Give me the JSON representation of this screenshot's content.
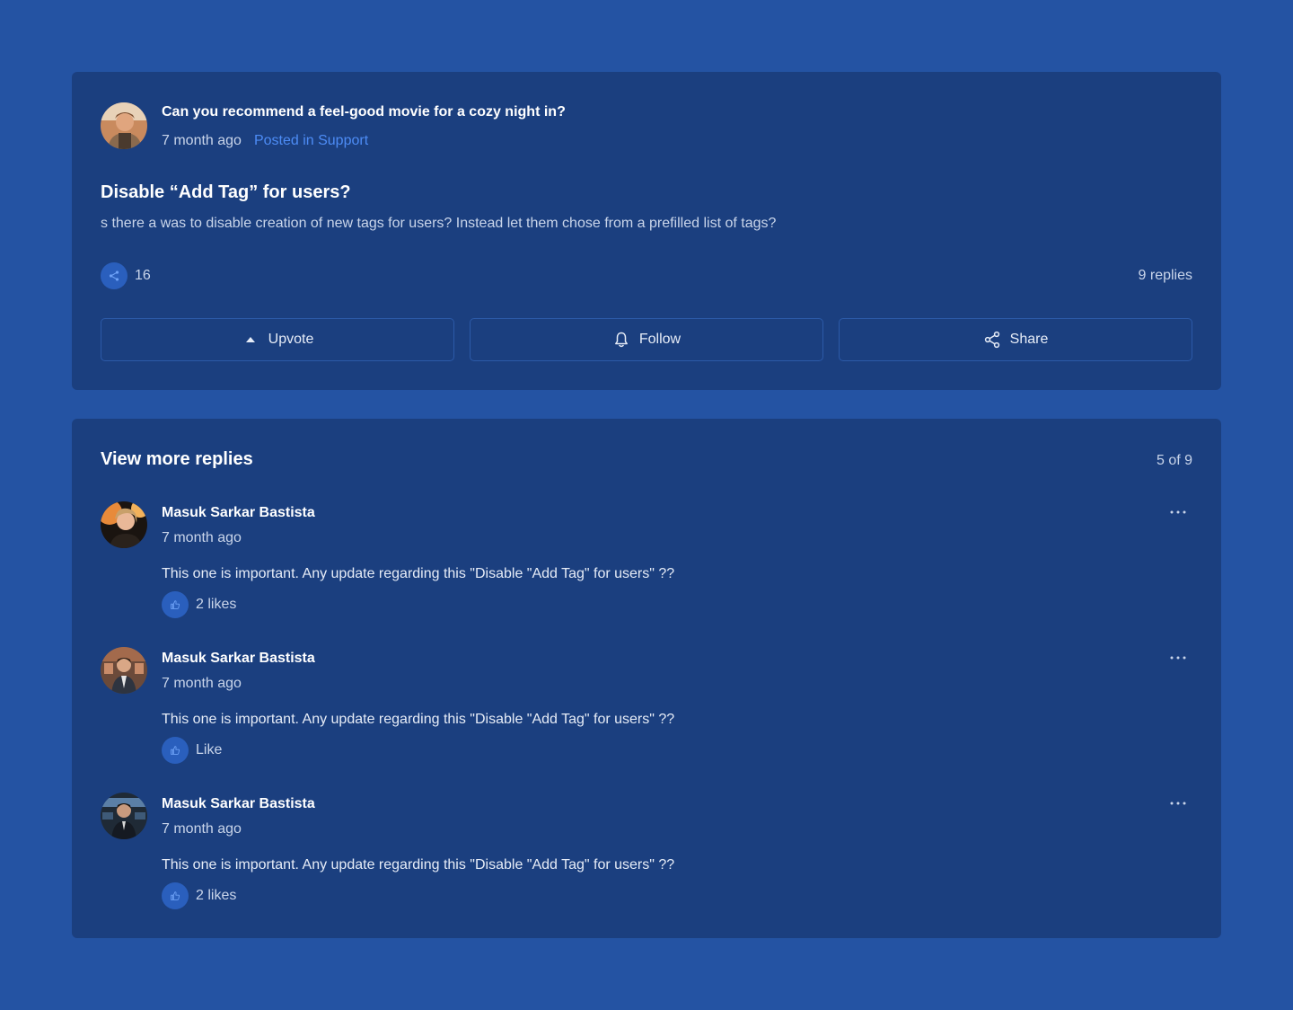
{
  "post": {
    "title": "Can you recommend a feel-good movie for a cozy night in?",
    "time": "7 month ago",
    "category": "Posted in Support",
    "question_title": "Disable “Add Tag” for users?",
    "question_body": "s there a was to disable creation of new tags for users? Instead let them chose from a prefilled list of tags?",
    "share_count": "16",
    "replies_count": "9 replies",
    "actions": {
      "upvote": "Upvote",
      "follow": "Follow",
      "share": "Share"
    }
  },
  "replies": {
    "heading": "View more replies",
    "pager": "5 of 9",
    "items": [
      {
        "name": "Masuk Sarkar Bastista",
        "time": "7 month ago",
        "body": "This one is important. Any update regarding this \"Disable \"Add Tag\" for users\" ??",
        "likes": "2 likes"
      },
      {
        "name": "Masuk Sarkar Bastista",
        "time": "7 month ago",
        "body": "This one is important. Any update regarding this \"Disable \"Add Tag\" for users\" ??",
        "likes": "Like"
      },
      {
        "name": "Masuk Sarkar Bastista",
        "time": "7 month ago",
        "body": "This one is important. Any update regarding this \"Disable \"Add Tag\" for users\" ??",
        "likes": "2 likes"
      }
    ]
  },
  "colors": {
    "page_bg": "#2453a3",
    "card_bg": "#1b3f7f",
    "accent": "#4d8cf5",
    "icon_circle": "#2a5fbd"
  },
  "icons": {
    "share_small": "share-icon",
    "upvote": "caret-up-icon",
    "follow": "bell-icon",
    "share": "share-icon",
    "like": "thumbs-up-icon",
    "more": "ellipsis-icon"
  }
}
